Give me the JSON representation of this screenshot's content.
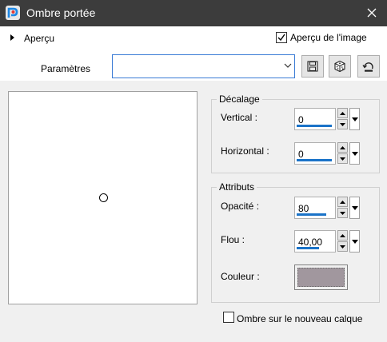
{
  "window": {
    "title": "Ombre portée",
    "app_icon": "paintshop-pro-icon"
  },
  "preview_section": {
    "label": "Aperçu",
    "expanded": false
  },
  "preview_image_checkbox": {
    "label": "Aperçu de l'image",
    "checked": true
  },
  "presets": {
    "label": "Paramètres",
    "value": ""
  },
  "toolbar_icons": [
    "save-icon",
    "dice-icon",
    "reset-icon"
  ],
  "offset_group": {
    "title": "Décalage",
    "vertical": {
      "label": "Vertical :",
      "value": "0",
      "fill": 0.95
    },
    "horizontal": {
      "label": "Horizontal :",
      "value": "0",
      "fill": 0.95
    }
  },
  "attributes_group": {
    "title": "Attributs",
    "opacity": {
      "label": "Opacité :",
      "value": "80",
      "fill": 0.8
    },
    "blur": {
      "label": "Flou :",
      "value": "40,00",
      "fill": 0.6
    },
    "color": {
      "label": "Couleur :",
      "value": "#a1979e"
    }
  },
  "new_layer_checkbox": {
    "label": "Ombre sur le nouveau calque",
    "checked": false
  }
}
